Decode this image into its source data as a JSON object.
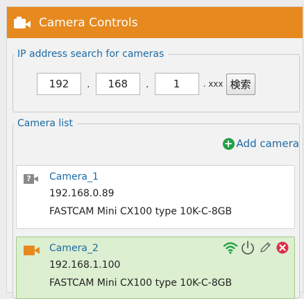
{
  "header": {
    "title": "Camera Controls",
    "icon": "camera-icon",
    "color": "#e6891f"
  },
  "ip_search": {
    "legend": "IP address search for cameras",
    "octets": [
      "192",
      "168",
      "1"
    ],
    "separator": ".",
    "suffix": ". xxx",
    "button_label": "検索"
  },
  "camera_list": {
    "legend": "Camera list",
    "add_label": "Add camera",
    "add_icon": "plus-circle-icon",
    "cameras": [
      {
        "name": "Camera_1",
        "ip": "192.168.0.89",
        "model": "FASTCAM Mini CX100 type 10K-C-8GB",
        "status_icon": "unknown-camera-icon",
        "selected": false
      },
      {
        "name": "Camera_2",
        "ip": "192.168.1.100",
        "model": "FASTCAM Mini CX100 type 10K-C-8GB",
        "status_icon": "camera-icon",
        "selected": true,
        "actions": [
          "wifi-icon",
          "power-icon",
          "edit-icon",
          "remove-icon"
        ]
      }
    ]
  },
  "colors": {
    "accent": "#e6891f",
    "link": "#1a6aa5",
    "success": "#23a046",
    "danger": "#d9304a",
    "selected_bg": "#dcefd0"
  }
}
